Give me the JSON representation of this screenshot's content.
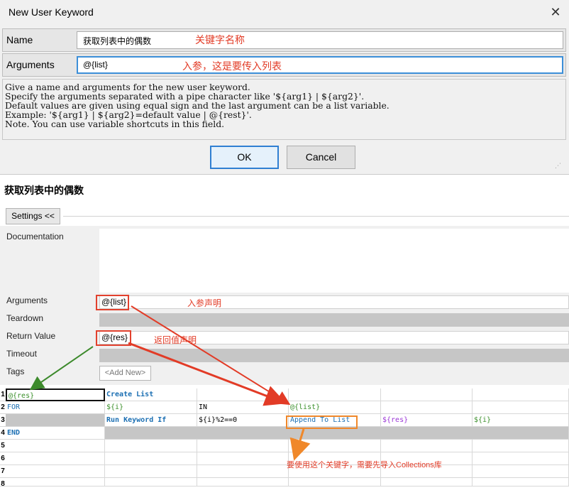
{
  "dialog": {
    "title": "New User Keyword",
    "close_glyph": "✕",
    "name_label": "Name",
    "name_value": "获取列表中的偶数",
    "name_note": "关键字名称",
    "arguments_label": "Arguments",
    "arguments_value": "@{list}",
    "arguments_note": "入参，这是要传入列表",
    "help_lines": [
      "Give a name and arguments for the new user keyword.",
      "Specify the arguments separated with a pipe character like '${arg1} | ${arg2}'.",
      "Default values are given using equal sign and the last argument can be a list variable.",
      "Example: '${arg1} | ${arg2}=default value | @{rest}'.",
      "Note. You can use variable shortcuts in this field."
    ],
    "ok_label": "OK",
    "cancel_label": "Cancel"
  },
  "editor": {
    "keyword_title": "获取列表中的偶数",
    "settings_button": "Settings <<",
    "documentation_label": "Documentation",
    "arguments_label": "Arguments",
    "arguments_value": "@{list}",
    "arguments_note": "入参声明",
    "teardown_label": "Teardown",
    "return_label": "Return Value",
    "return_value": "@{res}",
    "return_note": "返回值声明",
    "timeout_label": "Timeout",
    "tags_label": "Tags",
    "tags_add": "<Add New>"
  },
  "grid": {
    "row_numbers": [
      "1",
      "2",
      "3",
      "4",
      "5",
      "6",
      "7",
      "8"
    ],
    "rows": [
      [
        "@{res}",
        "Create List",
        "",
        "",
        "",
        ""
      ],
      [
        "FOR",
        "${i}",
        "IN",
        "@{list}",
        "",
        ""
      ],
      [
        "",
        "Run Keyword If",
        "${i}%2==0",
        "Append To List",
        "${res}",
        "${i}"
      ],
      [
        "END",
        "",
        "",
        "",
        "",
        ""
      ]
    ],
    "bottom_note": "要使用这个关键字，需要先导入Collections库"
  },
  "colors": {
    "annotation_red": "#e23b26",
    "annotation_orange": "#f0882a",
    "arrow_green": "#3d8a2c",
    "focus_blue": "#3c8fd8",
    "keyword_blue": "#1b6fb3",
    "variable_green": "#3a8f2a",
    "variable_purple": "#9b36d6"
  }
}
